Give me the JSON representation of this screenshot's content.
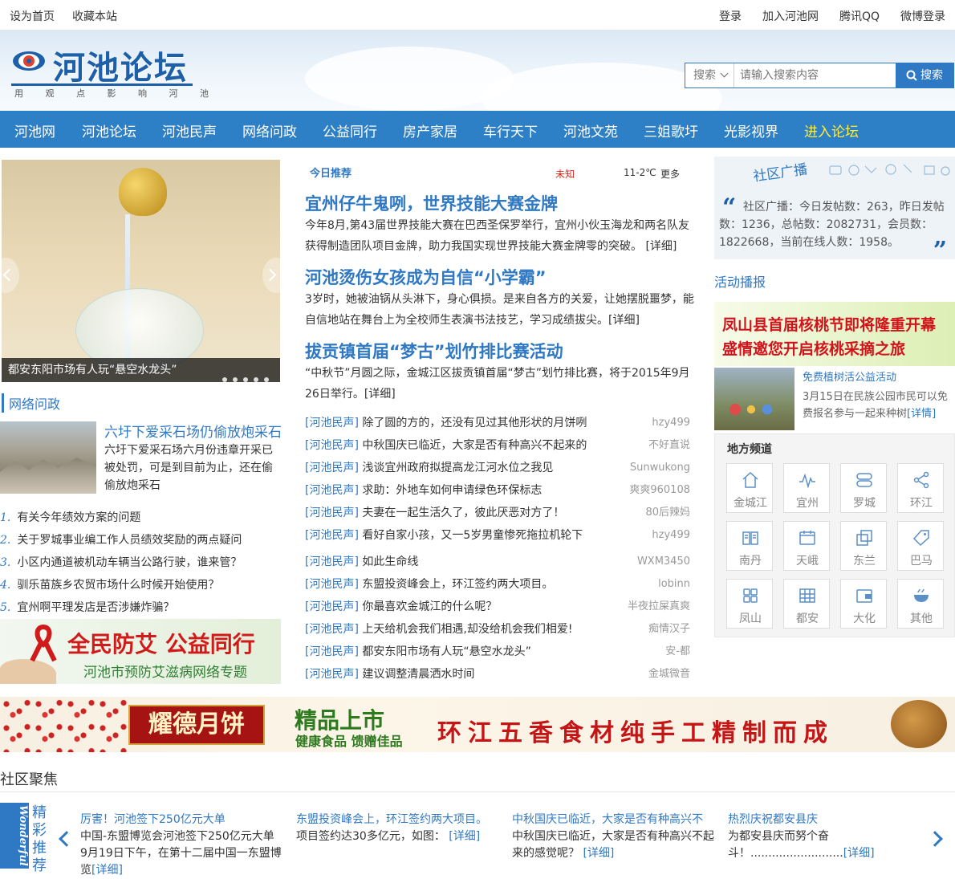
{
  "topbar": {
    "left": [
      "设为首页",
      "收藏本站"
    ],
    "right": [
      "登录",
      "加入河池网",
      "腾讯QQ",
      "微博登录"
    ]
  },
  "logo": {
    "text": "河池论坛",
    "slogan": "用 观 点 影 响 河 池"
  },
  "search": {
    "category": "搜索",
    "placeholder": "请输入搜索内容",
    "button": "搜索"
  },
  "nav": [
    "河池网",
    "河池论坛",
    "河池民声",
    "网络问政",
    "公益同行",
    "房产家居",
    "车行天下",
    "河池文苑",
    "三姐歌圩",
    "光影视界",
    "进入论坛"
  ],
  "slider": {
    "caption": "都安东阳市场有人玩“悬空水龙头”"
  },
  "politics": {
    "title": "网络问政",
    "featured_title": "六圩下爱采石场仍偷放炮采石",
    "featured_text": "六圩下爱采石场六月份违章开采已被处罚，可是到目前为止，还在偷偷放炮采石",
    "list": [
      {
        "num": "1.",
        "text": "有关今年绩效方案的问题"
      },
      {
        "num": "2.",
        "text": "关于罗城事业编工作人员绩效奖励的两点疑问"
      },
      {
        "num": "3.",
        "text": "小区内通道被机动车辆当公路行驶，谁来管？"
      },
      {
        "num": "4.",
        "text": "驯乐苗族乡农贸市场什么时候开始使用？"
      },
      {
        "num": "5.",
        "text": "宜州啊平理发店是否涉嫌炸骗？"
      }
    ]
  },
  "ad_aids": {
    "line1": "全民防艾  公益同行",
    "line2": "河池市预防艾滋病网络专题"
  },
  "today": {
    "label": "今日推荐",
    "weather_city": "未知",
    "temp": "11-2℃",
    "more": "更多"
  },
  "news": [
    {
      "title": "宜州仔牛鬼咧，世界技能大赛金牌",
      "text": "今年8月,第43届世界技能大赛在巴西圣保罗举行，宜州小伙玉海龙和两名队友获得制造团队项目金牌，助力我国实现世界技能大赛金牌零的突破。",
      "more": "[详细]"
    },
    {
      "title": "河池烫伤女孩成为自信“小学霸”",
      "text": "3岁时，她被油锅从头淋下，身心俱损。是来自各方的关爱，让她摆脱噩梦，能自信地站在舞台上为全校师生表演书法技艺，学习成绩拔尖。",
      "more": "[详细]"
    },
    {
      "title": "拔贡镇首届“梦古”划竹排比赛活动",
      "text": "“中秋节”月圆之际，金城江区拔贡镇首届“梦古”划竹排比赛，将于2015年9月26日举行。",
      "more": "[详细]"
    }
  ],
  "list1": [
    {
      "cat": "[河池民声]",
      "title": "除了圆的方的，还没有见过其他形状的月饼咧",
      "author": "hzy499"
    },
    {
      "cat": "[河池民声]",
      "title": "中秋国庆已临近，大家是否有种高兴不起来的",
      "author": "不好直说"
    },
    {
      "cat": "[河池民声]",
      "title": "浅谈宜州政府拟提高龙江河水位之我见",
      "author": "Sunwukong"
    },
    {
      "cat": "[河池民声]",
      "title": "求助：外地车如何申请绿色环保标志",
      "author": "爽爽960108"
    },
    {
      "cat": "[河池民声]",
      "title": "夫妻在一起生活久了，彼此厌恶对方了！",
      "author": "80后辣妈"
    },
    {
      "cat": "[河池民声]",
      "title": "看好自家小孩，又一5岁男童惨死拖拉机轮下",
      "author": "hzy499"
    }
  ],
  "list2": [
    {
      "cat": "[河池民声]",
      "title": "如此生命线",
      "author": "WXM3450"
    },
    {
      "cat": "[河池民声]",
      "title": "东盟投资峰会上，环江签约两大项目。",
      "author": "lobinn"
    },
    {
      "cat": "[河池民声]",
      "title": "你最喜欢金城江的什么呢？",
      "author": "半夜拉屎真爽"
    },
    {
      "cat": "[河池民声]",
      "title": "上天给机会我们相遇,却没给机会我们相爱!",
      "author": "痴情汉子"
    },
    {
      "cat": "[河池民声]",
      "title": "都安东阳市场有人玩“悬空水龙头”",
      "author": "安-都"
    },
    {
      "cat": "[河池民声]",
      "title": "建议调整清晨洒水时间",
      "author": "金城微音"
    }
  ],
  "community": {
    "title": "社区广播",
    "text": "社区广播：今日发帖数：263，昨日发帖数：1236，总帖数：2082731，会员数：1822668，当前在线人数：1958。"
  },
  "activity": {
    "title": "活动播报",
    "ad_line1": "凤山县首届核桃节即将隆重开幕",
    "ad_line2": "盛情邀您开启核桃采摘之旅",
    "item_title": "免费植树活公益活动",
    "item_text": "3月15日在民族公园市民可以免费报名参与一起来种树",
    "item_more": "[详情]"
  },
  "local": {
    "title": "地方频道",
    "tiles": [
      {
        "label": "金城江",
        "icon": "home-icon"
      },
      {
        "label": "宜州",
        "icon": "pulse-icon"
      },
      {
        "label": "罗城",
        "icon": "toggle-icon"
      },
      {
        "label": "环江",
        "icon": "share-icon"
      },
      {
        "label": "南丹",
        "icon": "book-icon"
      },
      {
        "label": "天峨",
        "icon": "calendar-icon"
      },
      {
        "label": "东兰",
        "icon": "copy-icon"
      },
      {
        "label": "巴马",
        "icon": "tag-icon"
      },
      {
        "label": "凤山",
        "icon": "grid-icon"
      },
      {
        "label": "都安",
        "icon": "table-icon"
      },
      {
        "label": "大化",
        "icon": "wallet-icon"
      },
      {
        "label": "其他",
        "icon": "bowl-icon"
      }
    ]
  },
  "banner": {
    "brand": "耀德月饼",
    "slogan1": "精品上市",
    "slogan2": "健康食品 馈赠佳品",
    "slogan3": "环江五香食材纯手工精制而成"
  },
  "focus": {
    "title": "社区聚焦",
    "side_en": "Wonderful",
    "side_cn": "精彩推荐",
    "cards": [
      {
        "title": "厉害！河池签下250亿元大单",
        "text": "中国-东盟博览会河池签下250亿元大单 9月19日下午，在第十二届中国一东盟博览",
        "more": "[详细]"
      },
      {
        "title": "东盟投资峰会上，环江签约两大项目。",
        "text": "项目签约达30多亿元，如图：",
        "more": "[详细]"
      },
      {
        "title": "中秋国庆已临近，大家是否有种高兴不",
        "text": "中秋国庆已临近，大家是否有种高兴不起来的感觉呢？",
        "more": "[详细]"
      },
      {
        "title": "热烈庆祝都安县庆",
        "text": "为都安县庆而努个奋斗！..........................",
        "more": "[详细]"
      }
    ]
  }
}
